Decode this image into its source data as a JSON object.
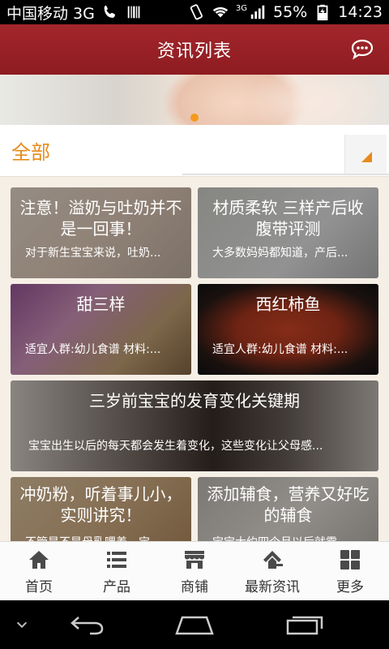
{
  "status_bar": {
    "carrier": "中国移动 3G",
    "network_label": "3G",
    "battery": "55%",
    "time": "14:23"
  },
  "header": {
    "title": "资讯列表"
  },
  "category": {
    "selected": "全部"
  },
  "articles": [
    {
      "title": "注意！溢奶与吐奶并不是一回事！",
      "summary": "对于新生宝宝来说，吐奶..."
    },
    {
      "title": "材质柔软 三样产后收腹带评测",
      "summary": "大多数妈妈都知道，产后..."
    },
    {
      "title": "甜三样",
      "summary": "适宜人群:幼儿食谱 材料:..."
    },
    {
      "title": "西红柿鱼",
      "summary": "适宜人群:幼儿食谱 材料:..."
    },
    {
      "title": "三岁前宝宝的发育变化关键期",
      "summary": "宝宝出生以后的每天都会发生着变化，这些变化让父母感..."
    },
    {
      "title": "冲奶粉，听着事儿小，实则讲究！",
      "summary": "不管是不是母乳喂养，宝..."
    },
    {
      "title": "添加辅食，营养又好吃的辅食",
      "summary": "宝宝大约四个月以后就需..."
    }
  ],
  "bottom_nav": [
    {
      "label": "首页",
      "icon": "home-icon"
    },
    {
      "label": "产品",
      "icon": "list-icon"
    },
    {
      "label": "商铺",
      "icon": "store-icon"
    },
    {
      "label": "最新资讯",
      "icon": "news-icon"
    },
    {
      "label": "更多",
      "icon": "grid-icon"
    }
  ],
  "colors": {
    "header_red": "#9b2227",
    "accent_orange": "#e58b1a",
    "page_bg": "#f6efe6"
  }
}
